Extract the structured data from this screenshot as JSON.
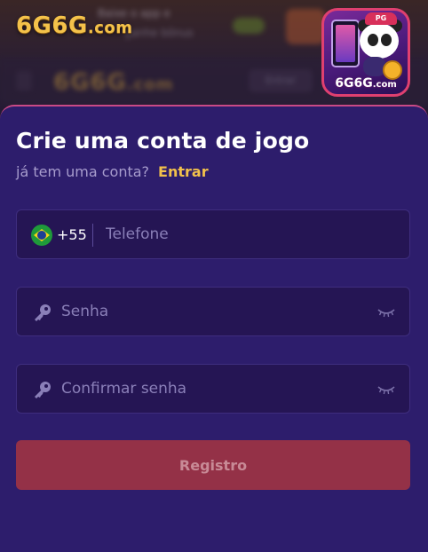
{
  "header": {
    "logo_main": "6G6G",
    "logo_suffix": ".com",
    "bg_text_1": "Baixe o app e",
    "bg_text_2": "ganhe bônus",
    "bg_button": "Entrar"
  },
  "app_icon": {
    "label_main": "6G6G",
    "label_suffix": ".com",
    "cap_text": "PG"
  },
  "form": {
    "title": "Crie uma conta de jogo",
    "subtitle": "já tem uma conta?",
    "login_link": "Entrar",
    "phone": {
      "country_flag": "brazil-flag",
      "dial_code": "+55",
      "placeholder": "Telefone",
      "value": ""
    },
    "password": {
      "placeholder": "Senha",
      "value": ""
    },
    "confirm_password": {
      "placeholder": "Confirmar senha",
      "value": ""
    },
    "submit_label": "Registro"
  },
  "colors": {
    "panel_bg": "#2d1d6c",
    "field_bg": "#251554",
    "accent_gold": "#f2c14b",
    "submit_bg": "#943147",
    "panel_border": "#c94a86"
  }
}
